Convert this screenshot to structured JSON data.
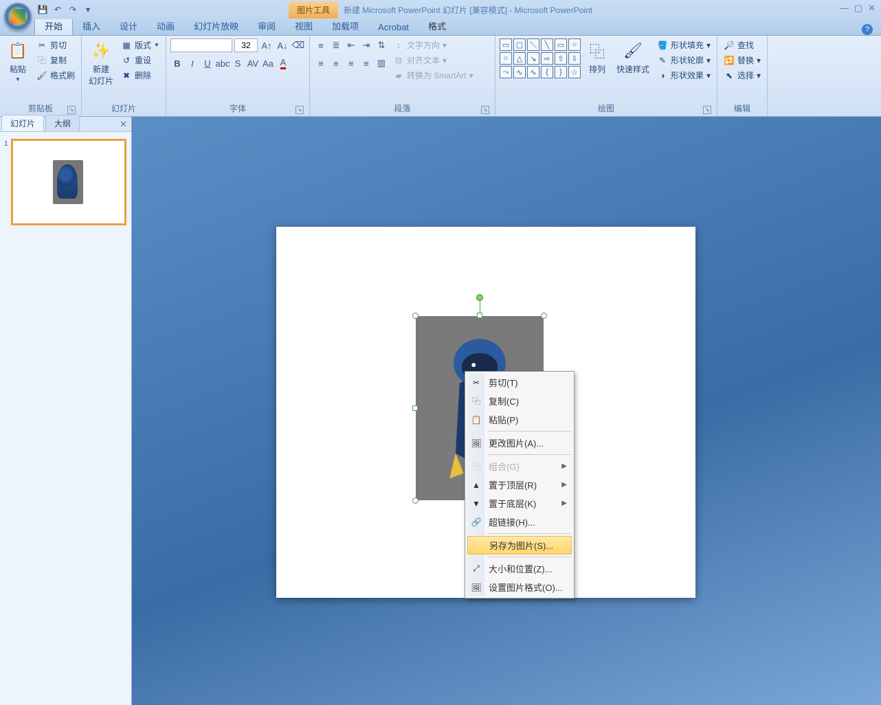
{
  "titlebar": {
    "context_tool": "图片工具",
    "doc_title": "新建 Microsoft PowerPoint 幻灯片 [兼容模式] - Microsoft PowerPoint"
  },
  "tabs": {
    "home": "开始",
    "insert": "插入",
    "design": "设计",
    "animation": "动画",
    "slideshow": "幻灯片放映",
    "review": "审阅",
    "view": "视图",
    "addins": "加载项",
    "acrobat": "Acrobat",
    "format": "格式"
  },
  "clipboard": {
    "paste": "粘贴",
    "cut": "剪切",
    "copy": "复制",
    "format_painter": "格式刷",
    "group_label": "剪贴板"
  },
  "slides": {
    "new_slide": "新建\n幻灯片",
    "layout": "版式",
    "reset": "重设",
    "delete": "删除",
    "group_label": "幻灯片"
  },
  "font": {
    "size": "32",
    "group_label": "字体"
  },
  "paragraph": {
    "text_direction": "文字方向",
    "align_text": "对齐文本",
    "convert_smartart": "转换为 SmartArt",
    "group_label": "段落"
  },
  "drawing": {
    "arrange": "排列",
    "quick_styles": "快速样式",
    "shape_fill": "形状填充",
    "shape_outline": "形状轮廓",
    "shape_effects": "形状效果",
    "group_label": "绘图"
  },
  "editing": {
    "find": "查找",
    "replace": "替换",
    "select": "选择",
    "group_label": "编辑"
  },
  "sidepanel": {
    "tab_slides": "幻灯片",
    "tab_outline": "大纲",
    "slide_number": "1"
  },
  "context_menu": {
    "cut": "剪切(T)",
    "copy": "复制(C)",
    "paste": "粘贴(P)",
    "change_picture": "更改图片(A)...",
    "group": "组合(G)",
    "bring_front": "置于顶层(R)",
    "send_back": "置于底层(K)",
    "hyperlink": "超链接(H)...",
    "save_as_picture": "另存为图片(S)...",
    "size_position": "大小和位置(Z)...",
    "format_picture": "设置图片格式(O)..."
  }
}
